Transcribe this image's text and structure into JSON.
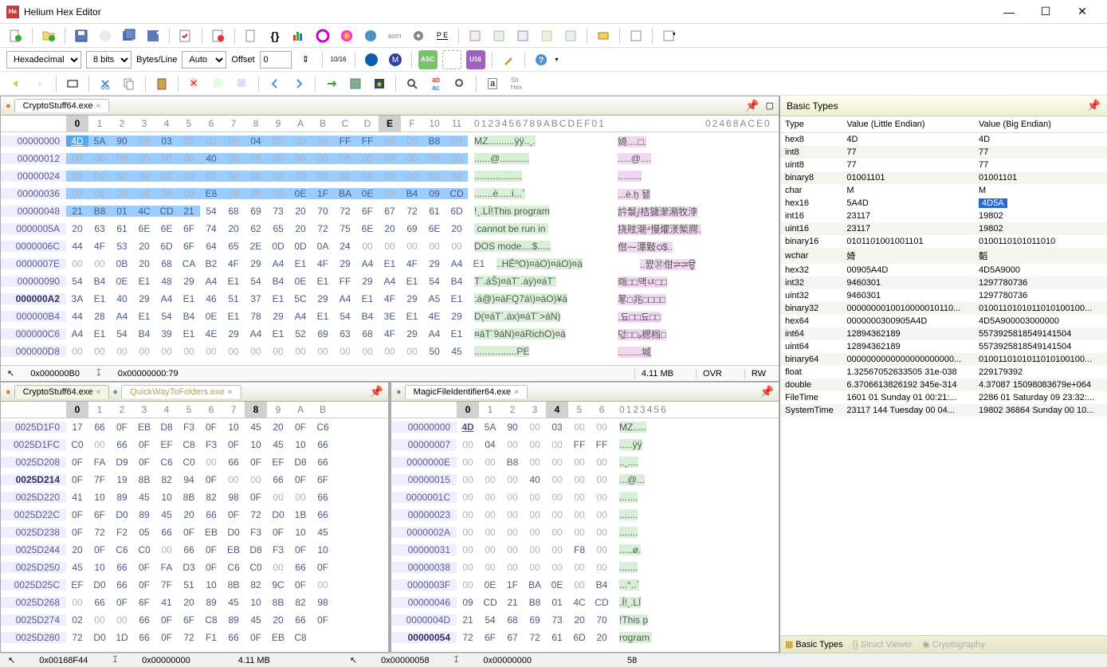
{
  "window": {
    "title": "Helium Hex Editor"
  },
  "toolbar2": {
    "format": "Hexadecimal",
    "bits": "8 bits",
    "bytesPer": "Bytes/Line",
    "auto": "Auto",
    "offsetLabel": "Offset",
    "offsetVal": "0"
  },
  "topPane": {
    "tab": "CryptoStuff64.exe",
    "cols": [
      "0",
      "1",
      "2",
      "3",
      "4",
      "5",
      "6",
      "7",
      "8",
      "9",
      "A",
      "B",
      "C",
      "D",
      "E",
      "F",
      "10",
      "11"
    ],
    "asciiHdr1": "0123456789ABCDEF01",
    "asciiHdr2": "02468ACE0",
    "rows": [
      {
        "o": "00000000",
        "b": [
          "4D",
          "5A",
          "90",
          "00",
          "03",
          "00",
          "00",
          "00",
          "04",
          "00",
          "00",
          "00",
          "FF",
          "FF",
          "00",
          "00",
          "B8",
          "00"
        ],
        "a1": "MZ..........ÿÿ..¸.",
        "a2": "婍....□."
      },
      {
        "o": "00000012",
        "b": [
          "00",
          "00",
          "00",
          "00",
          "00",
          "00",
          "40",
          "00",
          "00",
          "00",
          "00",
          "00",
          "00",
          "00",
          "00",
          "00",
          "00",
          "00"
        ],
        "a1": "......@...........",
        "a2": ".....@...."
      },
      {
        "o": "00000024",
        "b": [
          "00",
          "00",
          "00",
          "00",
          "00",
          "00",
          "00",
          "00",
          "00",
          "00",
          "00",
          "00",
          "00",
          "00",
          "00",
          "00",
          "00",
          "00"
        ],
        "a1": "..................",
        "a2": "........."
      },
      {
        "o": "00000036",
        "b": [
          "00",
          "00",
          "00",
          "00",
          "00",
          "00",
          "E8",
          "00",
          "00",
          "00",
          "0E",
          "1F",
          "BA",
          "0E",
          "00",
          "B4",
          "09",
          "CD"
        ],
        "a1": ".......è.....í...´",
        "a2": "...è.ẖ 됕"
      },
      {
        "o": "00000048",
        "b": [
          "21",
          "B8",
          "01",
          "4C",
          "CD",
          "21",
          "54",
          "68",
          "69",
          "73",
          "20",
          "70",
          "72",
          "6F",
          "67",
          "72",
          "61",
          "6D"
        ],
        "a1": "!¸.LÍ!This program",
        "a2": "訡䰁ⅉ桔獩瀠潲牧浡"
      },
      {
        "o": "0000005A",
        "b": [
          "20",
          "63",
          "61",
          "6E",
          "6E",
          "6F",
          "74",
          "20",
          "62",
          "65",
          "20",
          "72",
          "75",
          "6E",
          "20",
          "69",
          "6E",
          "20"
        ],
        "a1": " cannot be run in ",
        "a2": "挠䝮潮⁴慢爠湵椠腭."
      },
      {
        "o": "0000006C",
        "b": [
          "44",
          "4F",
          "53",
          "20",
          "6D",
          "6F",
          "64",
          "65",
          "2E",
          "0D",
          "0D",
          "0A",
          "24",
          "00",
          "00",
          "00",
          "00",
          "00"
        ],
        "a1": "DOS mode....$.....",
        "a2": "佄⁓潭敤ഠ$.."
      },
      {
        "o": "0000007E",
        "b": [
          "00",
          "00",
          "0B",
          "20",
          "68",
          "CA",
          "B2",
          "4F",
          "29",
          "A4",
          "E1",
          "4F",
          "29",
          "A4",
          "E1",
          "4F",
          "29",
          "A4",
          "E1"
        ],
        "a1": "..HÊºO)¤áO)¤áO)¤á",
        "a2": "..쨠㊲佄⥩⥩ਉ"
      },
      {
        "o": "00000090",
        "b": [
          "54",
          "B4",
          "0E",
          "E1",
          "48",
          "29",
          "A4",
          "E1",
          "54",
          "B4",
          "0E",
          "E1",
          "FF",
          "29",
          "A4",
          "E1",
          "54",
          "B4"
        ],
        "a1": "T´.áŠ)¤áT´.áÿ)¤áT´",
        "a2": "뢔□□맥ﾥ□□"
      },
      {
        "o": "000000A2",
        "b": [
          "3A",
          "E1",
          "40",
          "29",
          "A4",
          "E1",
          "46",
          "51",
          "37",
          "E1",
          "5C",
          "29",
          "A4",
          "E1",
          "4F",
          "29",
          "A5",
          "E1"
        ],
        "a1": ":á@)¤áFQ7á\\)¤áO)¥á",
        "a2": "㫡□兆□□□□"
      },
      {
        "o": "000000B4",
        "b": [
          "44",
          "28",
          "A4",
          "E1",
          "54",
          "B4",
          "0E",
          "E1",
          "78",
          "29",
          "A4",
          "E1",
          "54",
          "B4",
          "3E",
          "E1",
          "4E",
          "29"
        ],
        "a1": "D(¤áT´.áx)¤áT´>áN)",
        "a2": ".됴□□됴□□"
      },
      {
        "o": "000000C6",
        "b": [
          "A4",
          "E1",
          "54",
          "B4",
          "39",
          "E1",
          "4E",
          "29",
          "A4",
          "E1",
          "52",
          "69",
          "63",
          "68",
          "4F",
          "29",
          "A4",
          "E1"
        ],
        "a1": "¤áT´9áN)¤áRichO)¤á",
        "a2": "덗□□ₔ楒档□"
      },
      {
        "o": "000000D8",
        "b": [
          "00",
          "00",
          "00",
          "00",
          "00",
          "00",
          "00",
          "00",
          "00",
          "00",
          "00",
          "00",
          "00",
          "00",
          "00",
          "00",
          "50",
          "45"
        ],
        "a1": "................PE",
        "a2": ".........堿"
      }
    ],
    "status": {
      "cursor": "0x000000B0",
      "sel": "0x00000000:79",
      "size": "4.11 MB",
      "mode": "OVR",
      "rw": "RW"
    }
  },
  "bl": {
    "tabs": [
      "CryptoStuff64.exe",
      "QuickWayToFolders.exe"
    ],
    "cols": [
      "0",
      "1",
      "2",
      "3",
      "4",
      "5",
      "6",
      "7",
      "8",
      "9",
      "A",
      "B"
    ],
    "rows": [
      {
        "o": "0025D1F0",
        "b": [
          "17",
          "66",
          "0F",
          "EB",
          "D8",
          "F3",
          "0F",
          "10",
          "45",
          "20",
          "0F",
          "C6"
        ]
      },
      {
        "o": "0025D1FC",
        "b": [
          "C0",
          "00",
          "66",
          "0F",
          "EF",
          "C8",
          "F3",
          "0F",
          "10",
          "45",
          "10",
          "66"
        ]
      },
      {
        "o": "0025D208",
        "b": [
          "0F",
          "FA",
          "D9",
          "0F",
          "C6",
          "C0",
          "00",
          "66",
          "0F",
          "EF",
          "D8",
          "66"
        ]
      },
      {
        "o": "0025D214",
        "b": [
          "0F",
          "7F",
          "19",
          "8B",
          "82",
          "94",
          "0F",
          "00",
          "00",
          "66",
          "0F",
          "6F"
        ]
      },
      {
        "o": "0025D220",
        "b": [
          "41",
          "10",
          "89",
          "45",
          "10",
          "8B",
          "82",
          "98",
          "0F",
          "00",
          "00",
          "66"
        ]
      },
      {
        "o": "0025D22C",
        "b": [
          "0F",
          "6F",
          "D0",
          "89",
          "45",
          "20",
          "66",
          "0F",
          "72",
          "D0",
          "1B",
          "66"
        ]
      },
      {
        "o": "0025D238",
        "b": [
          "0F",
          "72",
          "F2",
          "05",
          "66",
          "0F",
          "EB",
          "D0",
          "F3",
          "0F",
          "10",
          "45"
        ]
      },
      {
        "o": "0025D244",
        "b": [
          "20",
          "0F",
          "C6",
          "C0",
          "00",
          "66",
          "0F",
          "EB",
          "D8",
          "F3",
          "0F",
          "10"
        ]
      },
      {
        "o": "0025D250",
        "b": [
          "45",
          "10",
          "66",
          "0F",
          "FA",
          "D3",
          "0F",
          "C6",
          "C0",
          "00",
          "66",
          "0F"
        ]
      },
      {
        "o": "0025D25C",
        "b": [
          "EF",
          "D0",
          "66",
          "0F",
          "7F",
          "51",
          "10",
          "8B",
          "82",
          "9C",
          "0F",
          "00"
        ]
      },
      {
        "o": "0025D268",
        "b": [
          "00",
          "66",
          "0F",
          "6F",
          "41",
          "20",
          "89",
          "45",
          "10",
          "8B",
          "82",
          "98"
        ]
      },
      {
        "o": "0025D274",
        "b": [
          "02",
          "00",
          "00",
          "66",
          "0F",
          "6F",
          "C8",
          "89",
          "45",
          "20",
          "66",
          "0F"
        ]
      },
      {
        "o": "0025D280",
        "b": [
          "72",
          "D0",
          "1D",
          "66",
          "0F",
          "72",
          "F1",
          "66",
          "0F",
          "EB",
          "C8"
        ]
      }
    ]
  },
  "br": {
    "tab": "MagicFileIdentifier64.exe",
    "cols": [
      "0",
      "1",
      "2",
      "3",
      "4",
      "5",
      "6"
    ],
    "asciiHdr": "0123456",
    "rows": [
      {
        "o": "00000000",
        "b": [
          "4D",
          "5A",
          "90",
          "00",
          "03",
          "00",
          "00"
        ],
        "a": "MZ....."
      },
      {
        "o": "00000007",
        "b": [
          "00",
          "04",
          "00",
          "00",
          "00",
          "FF",
          "FF"
        ],
        "a": ".....ÿÿ"
      },
      {
        "o": "0000000E",
        "b": [
          "00",
          "00",
          "B8",
          "00",
          "00",
          "00",
          "00"
        ],
        "a": "..¸...."
      },
      {
        "o": "00000015",
        "b": [
          "00",
          "00",
          "00",
          "40",
          "00",
          "00",
          "00"
        ],
        "a": "...@..."
      },
      {
        "o": "0000001C",
        "b": [
          "00",
          "00",
          "00",
          "00",
          "00",
          "00",
          "00"
        ],
        "a": "......."
      },
      {
        "o": "00000023",
        "b": [
          "00",
          "00",
          "00",
          "00",
          "00",
          "00",
          "00"
        ],
        "a": "......."
      },
      {
        "o": "0000002A",
        "b": [
          "00",
          "00",
          "00",
          "00",
          "00",
          "00",
          "00"
        ],
        "a": "......."
      },
      {
        "o": "00000031",
        "b": [
          "00",
          "00",
          "00",
          "00",
          "00",
          "F8",
          "00"
        ],
        "a": ".....ø."
      },
      {
        "o": "00000038",
        "b": [
          "00",
          "00",
          "00",
          "00",
          "00",
          "00",
          "00"
        ],
        "a": "......."
      },
      {
        "o": "0000003F",
        "b": [
          "00",
          "0E",
          "1F",
          "BA",
          "0E",
          "00",
          "B4"
        ],
        "a": "...°..´"
      },
      {
        "o": "00000046",
        "b": [
          "09",
          "CD",
          "21",
          "B8",
          "01",
          "4C",
          "CD"
        ],
        "a": ".Í!¸.LÍ"
      },
      {
        "o": "0000004D",
        "b": [
          "21",
          "54",
          "68",
          "69",
          "73",
          "20",
          "70"
        ],
        "a": "!This p"
      },
      {
        "o": "00000054",
        "b": [
          "72",
          "6F",
          "67",
          "72",
          "61",
          "6D",
          "20"
        ],
        "a": "rogram "
      }
    ],
    "status": {
      "cursor": "0x00000058",
      "sel": "0x00000000",
      "size": "58"
    }
  },
  "mainStatus": {
    "cursor": "0x00168F44",
    "sel": "0x00000000",
    "size": "4.11 MB"
  },
  "basicTypes": {
    "title": "Basic Types",
    "headers": [
      "Type",
      "Value (Little Endian)",
      "Value (Big Endian)"
    ],
    "rows": [
      [
        "hex8",
        "4D",
        "4D"
      ],
      [
        "int8",
        "77",
        "77"
      ],
      [
        "uint8",
        "77",
        "77"
      ],
      [
        "binary8",
        "01001101",
        "01001101"
      ],
      [
        "char",
        "M",
        "M"
      ],
      [
        "hex16",
        "5A4D",
        "4D5A"
      ],
      [
        "int16",
        "23117",
        "19802"
      ],
      [
        "uint16",
        "23117",
        "19802"
      ],
      [
        "binary16",
        "0101101001001101",
        "0100110101011010"
      ],
      [
        "wchar",
        "婍",
        "䵚"
      ],
      [
        "hex32",
        "00905A4D",
        "4D5A9000"
      ],
      [
        "int32",
        "9460301",
        "1297780736"
      ],
      [
        "uint32",
        "9460301",
        "1297780736"
      ],
      [
        "binary32",
        "0000000010010000010110...",
        "0100110101011010100100..."
      ],
      [
        "hex64",
        "0000000300905A4D",
        "4D5A900003000000"
      ],
      [
        "int64",
        "12894362189",
        "5573925818549141504"
      ],
      [
        "uint64",
        "12894362189",
        "5573925818549141504"
      ],
      [
        "binary64",
        "0000000000000000000000...",
        "0100110101011010100100..."
      ],
      [
        "float",
        "1.32567052633505 31e-038",
        "229179392"
      ],
      [
        "double",
        "6.3706613826192 345e-314",
        "4.37087 15098083679e+064"
      ],
      [
        "FileTime",
        "1601 01 Sunday 01 00:21:...",
        "2286 01 Saturday 09 23:32:..."
      ],
      [
        "SystemTime",
        "23117 144 Tuesday 00 04...",
        "19802 36864 Sunday 00 10..."
      ]
    ],
    "highlightedRow": 5
  },
  "bottomTabs": [
    {
      "label": "Basic Types",
      "active": true
    },
    {
      "label": "Struct Viewer",
      "active": false
    },
    {
      "label": "Cryptography",
      "active": false
    }
  ]
}
